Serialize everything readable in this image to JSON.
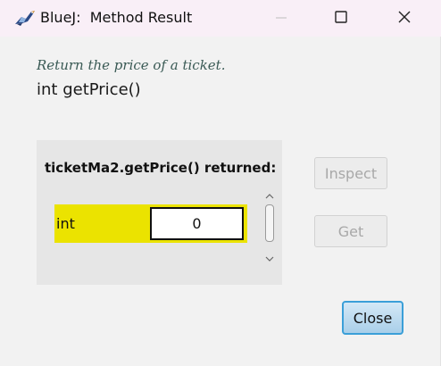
{
  "window": {
    "app_name": "BlueJ:",
    "title": "Method Result",
    "title_full": "BlueJ:  Method Result",
    "controls": [
      "minimize-icon",
      "maximize-icon",
      "close-icon"
    ]
  },
  "method": {
    "description": "Return the price of a ticket.",
    "signature": "int getPrice()"
  },
  "result": {
    "heading": "ticketMa2.getPrice() returned:",
    "type": "int",
    "value": "0"
  },
  "buttons": {
    "inspect": "Inspect",
    "get": "Get",
    "close": "Close"
  },
  "colors": {
    "titlebar_bg": "#f9eff7",
    "window_bg": "#f2f2f2",
    "result_panel_bg": "#e6e6e6",
    "result_highlight": "#ebe300",
    "close_button_border": "#3b9fd8",
    "description_text": "#3a5a55"
  }
}
